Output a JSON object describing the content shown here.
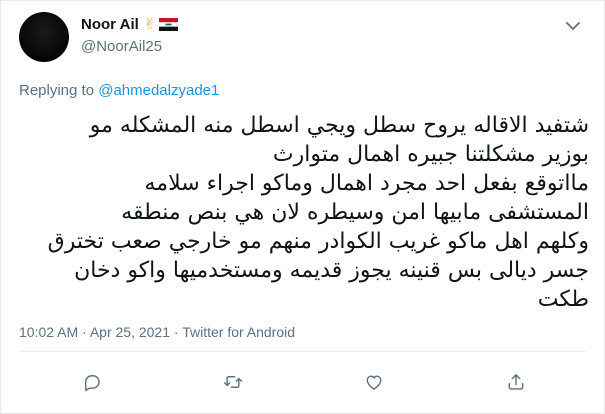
{
  "author": {
    "display_name": "Noor Ail",
    "badge_emoji": "✌",
    "flag_icon": "iraq-flag-icon",
    "handle": "@NoorAil25"
  },
  "reply": {
    "prefix": "Replying to ",
    "mention": "@ahmedalzyade1"
  },
  "tweet_lines": [
    "شتفيد الاقاله يروح سطل ويجي اسطل منه المشكله مو",
    "بوزير مشكلتنا جبيره اهمال متوارث",
    "مااتوقع بفعل احد مجرد اهمال وماكو اجراء سلامه",
    "المستشفى مابيها امن وسيطره لان هي بنص منطقه",
    "وكلهم اهل ماكو غريب الكوادر منهم مو خارجي صعب تخترق",
    "جسر ديالى بس قنينه يجوز قديمه ومستخدميها واكو دخان",
    "طكت"
  ],
  "meta": {
    "time": "10:02 AM",
    "separator": " · ",
    "date": "Apr 25, 2021",
    "source": "Twitter for Android"
  },
  "colors": {
    "text_primary": "#0f1419",
    "text_secondary": "#5b7083",
    "link": "#1b95e0",
    "divider": "#e6ecf0",
    "icon": "#5b7083"
  },
  "icons": [
    "chevron-down-icon",
    "reply-icon",
    "retweet-icon",
    "like-icon",
    "share-icon"
  ]
}
